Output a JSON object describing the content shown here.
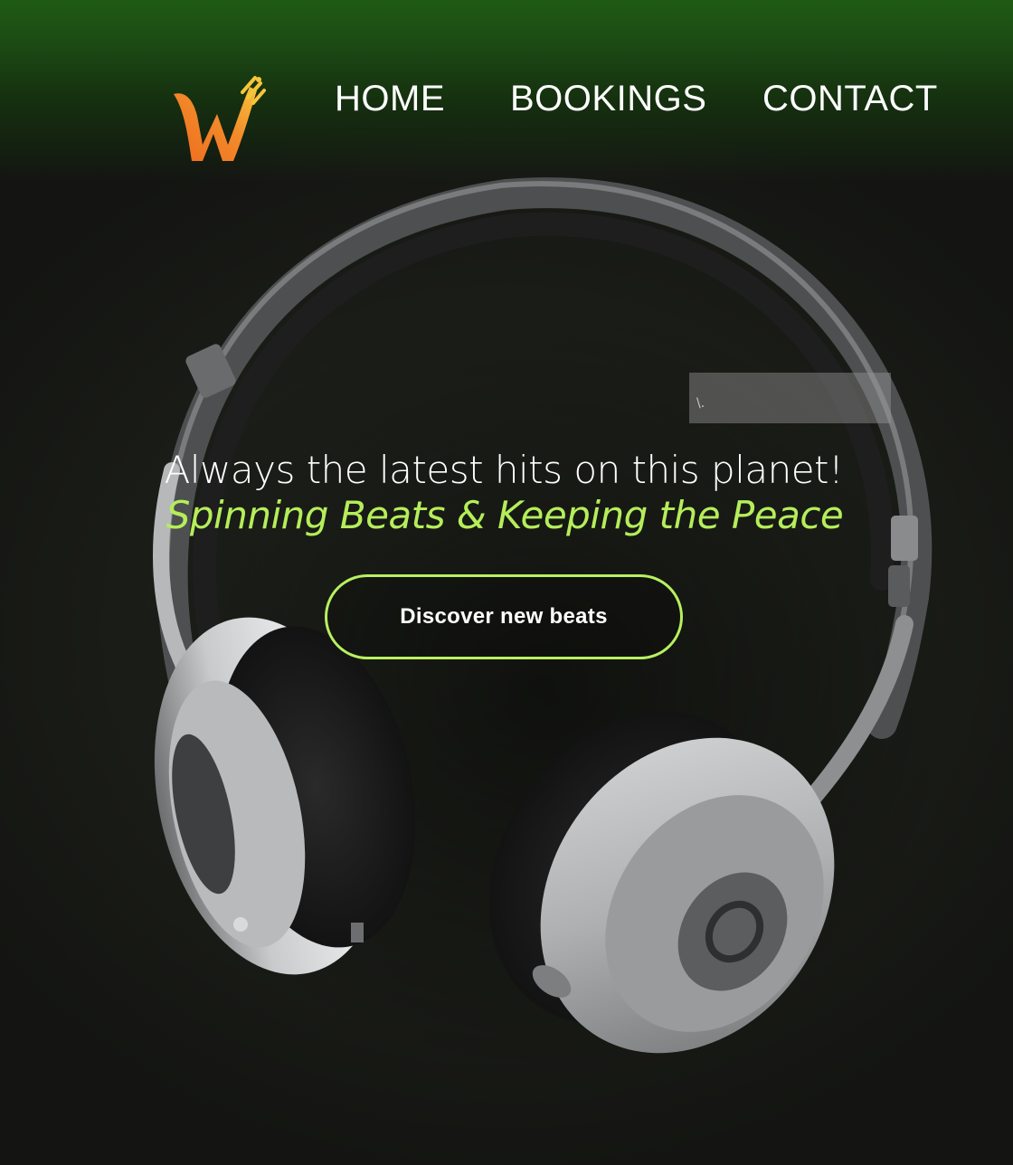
{
  "nav": {
    "logo_name": "w-logo",
    "items": [
      {
        "label": "HOME"
      },
      {
        "label": "BOOKINGS"
      },
      {
        "label": "CONTACT"
      }
    ]
  },
  "hero": {
    "headline": "Always the latest hits on this planet!",
    "tagline": "Spinning Beats & Keeping the Peace",
    "cta_label": "Discover new beats",
    "overlay_glyph": "\\."
  },
  "colors": {
    "accent": "#b8f060",
    "tagline": "#b5ee5a",
    "top_glow": "#1f5a14",
    "background": "#1a1c17",
    "logo_orange": "#f07a20",
    "logo_yellow": "#f6c23a"
  }
}
